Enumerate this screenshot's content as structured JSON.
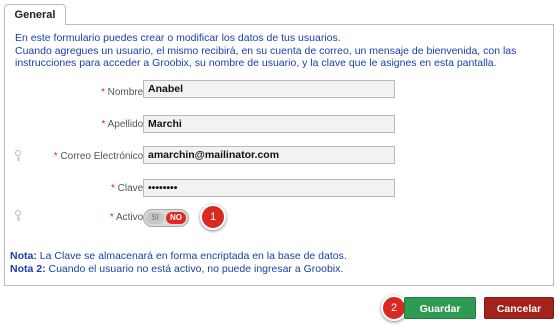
{
  "tab": {
    "label": "General"
  },
  "intro": {
    "line1": "En este formulario puedes crear o modificar los datos de tus usuarios.",
    "line2": "Cuando agregues un usuario, el mismo recibirá, en su cuenta de correo, un mensaje de bienvenida, con las",
    "line3": "instrucciones para acceder a Groobix, su nombre de usuario, y la clave que le asignes en esta pantalla."
  },
  "form": {
    "nombre": {
      "label": "Nombre:",
      "value": "Anabel"
    },
    "apellido": {
      "label": "Apellido:",
      "value": "Marchi"
    },
    "correo": {
      "label": "Correo Electrónico:",
      "value": "amarchin@mailinator.com"
    },
    "clave": {
      "label": "Clave:",
      "value": "••••••••"
    },
    "activo": {
      "label": "Activo:",
      "on_label": "SI",
      "off_label": "NO",
      "selected": "NO"
    },
    "required_mark": "*"
  },
  "callouts": {
    "one": "1",
    "two": "2"
  },
  "notes": {
    "nota1_prefix": "Nota:",
    "nota1_text": " La Clave se almacenará en forma encriptada en la base de datos.",
    "nota2_prefix": "Nota 2:",
    "nota2_text": " Cuando el usuario no está activo, no puede ingresar a Groobix."
  },
  "buttons": {
    "save": "Guardar",
    "cancel": "Cancelar"
  },
  "colors": {
    "accent_text": "#1a3fa8",
    "save": "#2e9a52",
    "cancel": "#a3231c",
    "toggle_off": "#e0291c",
    "callout": "#d8281f"
  }
}
